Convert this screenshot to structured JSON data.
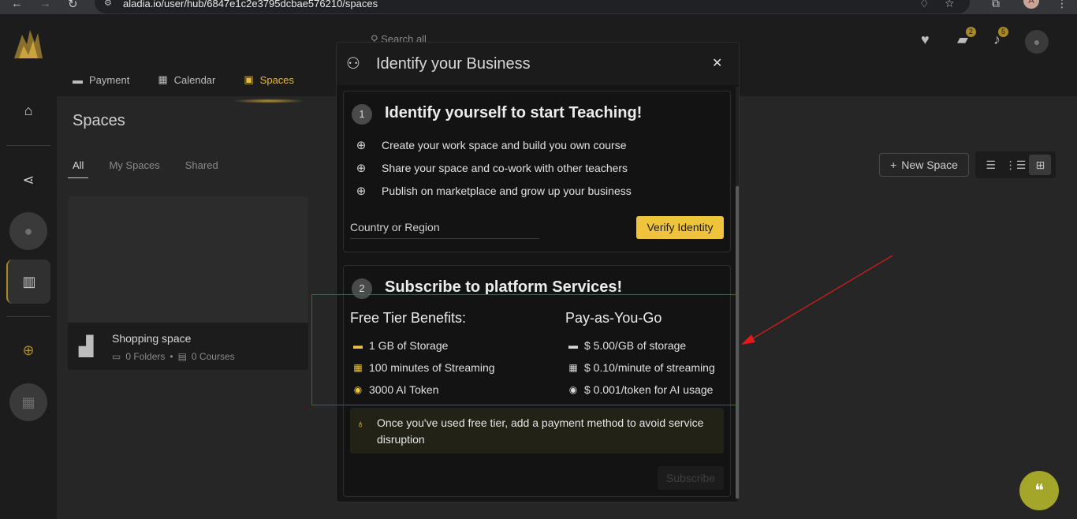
{
  "browser": {
    "url": "aladia.io/user/hub/6847e1c2e3795dcbae576210/spaces",
    "avatar_letter": "A"
  },
  "header": {
    "search_placeholder": "Search all",
    "tabs": [
      {
        "label": "Payment",
        "icon": "credit-card-icon"
      },
      {
        "label": "Calendar",
        "icon": "calendar-icon"
      },
      {
        "label": "Spaces",
        "icon": "briefcase-icon",
        "active": true
      }
    ],
    "messages_count": "2",
    "notifications_count": "5"
  },
  "main": {
    "title": "Spaces",
    "filters": [
      "All",
      "My Spaces",
      "Shared"
    ],
    "active_filter": "All",
    "new_space_label": "New Space",
    "card": {
      "title": "Shopping space",
      "folders": "0 Folders",
      "courses": "0 Courses"
    }
  },
  "modal": {
    "title": "Identify your Business",
    "section1": {
      "step": "1",
      "title": "Identify yourself to start Teaching!",
      "features": [
        "Create your work space and build you own course",
        "Share your space and co-work with other teachers",
        "Publish on marketplace and grow up your business"
      ],
      "country_placeholder": "Country or Region",
      "verify_label": "Verify Identity"
    },
    "section2": {
      "step": "2",
      "title": "Subscribe to platform Services!",
      "free_title": "Free Tier Benefits:",
      "free_items": [
        "1 GB of Storage",
        "100 minutes of Streaming",
        "3000 AI Token"
      ],
      "paygo_title": "Pay-as-You-Go",
      "paygo_items": [
        "$ 5.00/GB of storage",
        "$ 0.10/minute of streaming",
        "$ 0.001/token for AI usage"
      ],
      "notice": "Once you've used free tier, add a payment method to avoid service disruption",
      "subscribe_label": "Subscribe"
    }
  },
  "colors": {
    "accent": "#f0c43a",
    "annotation": "#e01b1b"
  }
}
